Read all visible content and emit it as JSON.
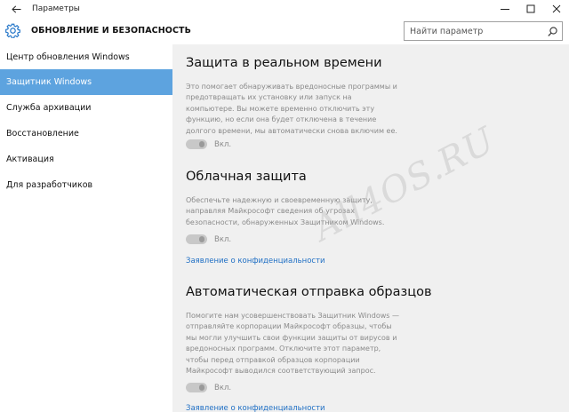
{
  "window": {
    "title": "Параметры",
    "back_icon": "back-arrow-icon",
    "controls": [
      "minimize-icon",
      "maximize-icon",
      "close-icon"
    ]
  },
  "header": {
    "icon": "gear-icon",
    "icon_color": "#2677c9",
    "title": "ОБНОВЛЕНИЕ И БЕЗОПАСНОСТЬ",
    "search_placeholder": "Найти параметр",
    "search_value": ""
  },
  "sidebar": {
    "active_color": "#5da3df",
    "items": [
      {
        "label": "Центр обновления Windows",
        "active": false
      },
      {
        "label": "Защитник Windows",
        "active": true
      },
      {
        "label": "Служба архивации",
        "active": false
      },
      {
        "label": "Восстановление",
        "active": false
      },
      {
        "label": "Активация",
        "active": false
      },
      {
        "label": "Для разработчиков",
        "active": false
      }
    ]
  },
  "main": {
    "background": "#f0f0f0",
    "link_color": "#1f6fc4",
    "sections": [
      {
        "title": "Защита в реальном времени",
        "description": "Это помогает обнаруживать вредоносные программы и предотвращать их установку или запуск на компьютере. Вы можете временно отключить эту функцию, но если она будет отключена в течение долгого времени, мы автоматически снова включим ее.",
        "toggle_label": "Вкл.",
        "toggle_on": true,
        "toggle_enabled": false
      },
      {
        "title": "Облачная защита",
        "description": "Обеспечьте надежную и своевременную защиту, направляя Майкрософт сведения об угрозах безопасности, обнаруженных Защитником Windows.",
        "toggle_label": "Вкл.",
        "toggle_on": true,
        "toggle_enabled": false,
        "link": "Заявление о конфиденциальности"
      },
      {
        "title": "Автоматическая отправка образцов",
        "description": "Помогите нам усовершенствовать Защитник Windows — отправляйте корпорации Майкрософт образцы, чтобы мы могли улучшить свои функции защиты от вирусов и вредоносных программ. Отключите этот параметр, чтобы перед отправкой образцов корпорации Майкрософт выводился соответствующий запрос.",
        "toggle_label": "Вкл.",
        "toggle_on": true,
        "toggle_enabled": false,
        "link": "Заявление о конфиденциальности"
      }
    ]
  },
  "watermark": "All4OS.RU"
}
